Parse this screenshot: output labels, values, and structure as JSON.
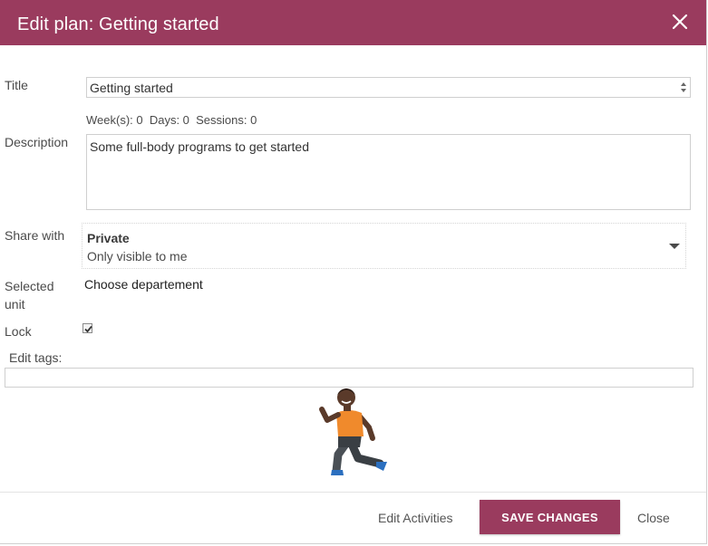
{
  "dialog": {
    "title": "Edit plan: Getting started",
    "accent_color": "#9a3b5e"
  },
  "form": {
    "title_label": "Title",
    "title_value": "Getting started",
    "stats": "Week(s): 0  Days: 0  Sessions: 0",
    "description_label": "Description",
    "description_value": "Some full-body programs to get started",
    "share_label": "Share with",
    "share_value": "Private",
    "share_subtext": "Only visible to me",
    "unit_label": "Selected unit",
    "unit_value": "Choose departement",
    "lock_label": "Lock",
    "lock_checked": true,
    "tags_label": "Edit tags:",
    "tags_value": ""
  },
  "footer": {
    "edit_activities": "Edit Activities",
    "save_changes": "SAVE CHANGES",
    "close": "Close"
  }
}
